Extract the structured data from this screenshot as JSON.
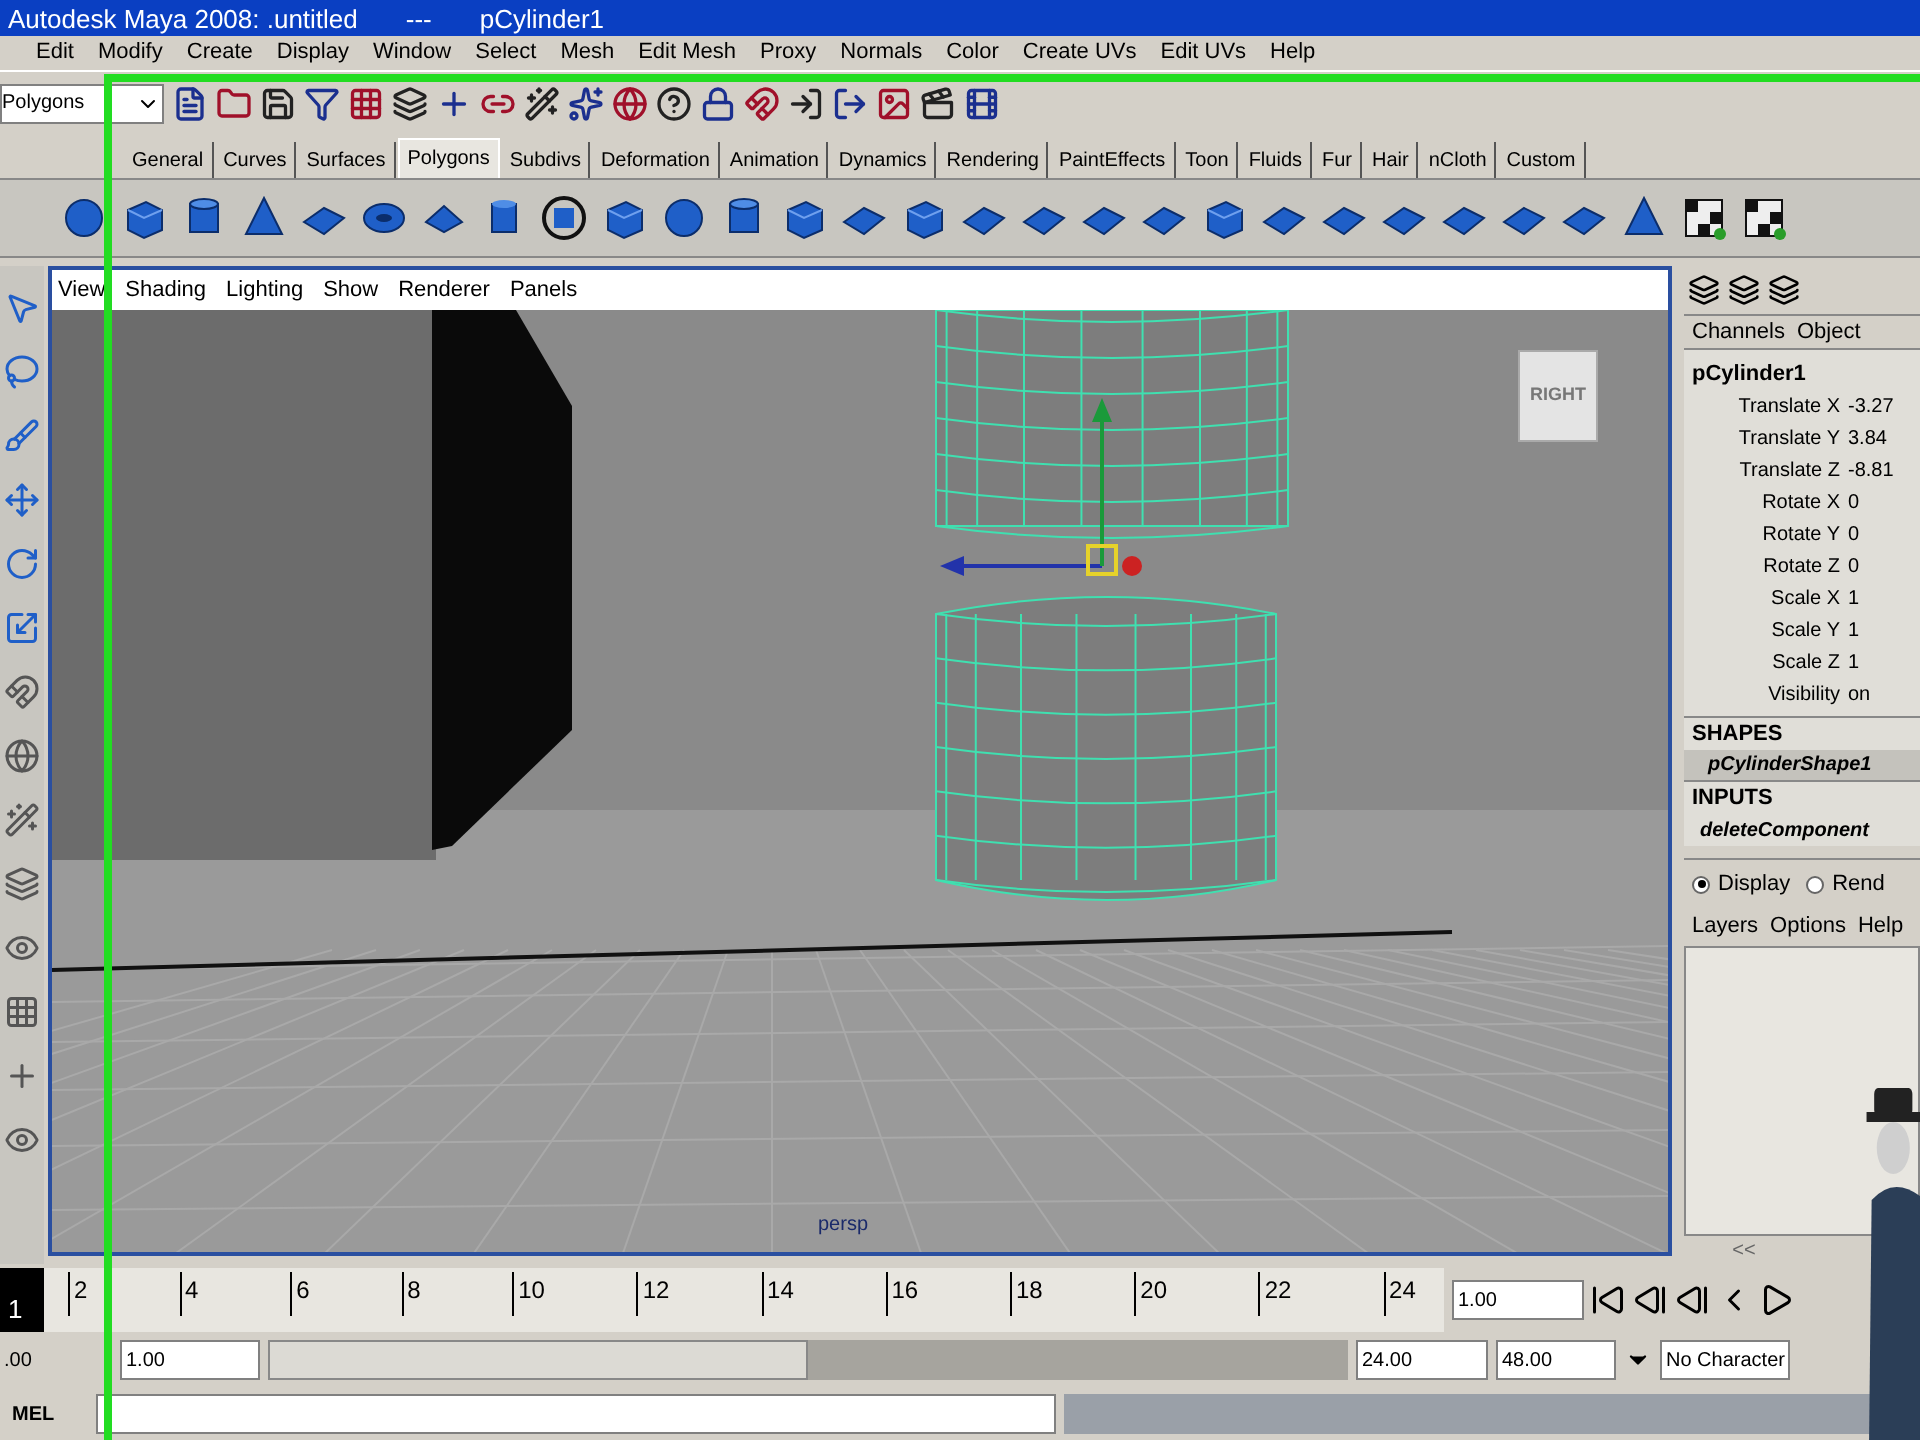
{
  "window": {
    "title": "Autodesk Maya 2008: .untitled",
    "separator": "---",
    "object": "pCylinder1"
  },
  "menu_bar": [
    "Edit",
    "Modify",
    "Create",
    "Display",
    "Window",
    "Select",
    "Mesh",
    "Edit Mesh",
    "Proxy",
    "Normals",
    "Color",
    "Create UVs",
    "Edit UVs",
    "Help"
  ],
  "status_line": {
    "menu_set": "Polygons"
  },
  "shelf_tabs": [
    {
      "label": "General",
      "selected": false
    },
    {
      "label": "Curves",
      "selected": false
    },
    {
      "label": "Surfaces",
      "selected": false
    },
    {
      "label": "Polygons",
      "selected": true
    },
    {
      "label": "Subdivs",
      "selected": false
    },
    {
      "label": "Deformation",
      "selected": false
    },
    {
      "label": "Animation",
      "selected": false
    },
    {
      "label": "Dynamics",
      "selected": false
    },
    {
      "label": "Rendering",
      "selected": false
    },
    {
      "label": "PaintEffects",
      "selected": false
    },
    {
      "label": "Toon",
      "selected": false
    },
    {
      "label": "Fluids",
      "selected": false
    },
    {
      "label": "Fur",
      "selected": false
    },
    {
      "label": "Hair",
      "selected": false
    },
    {
      "label": "nCloth",
      "selected": false
    },
    {
      "label": "Custom",
      "selected": false
    }
  ],
  "viewport": {
    "menu": [
      "View",
      "Shading",
      "Lighting",
      "Show",
      "Renderer",
      "Panels"
    ],
    "view_cube": "RIGHT",
    "camera": "persp"
  },
  "channel_box": {
    "menu": [
      "Channels",
      "Object"
    ],
    "object": "pCylinder1",
    "attributes": [
      {
        "name": "Translate X",
        "value": "-3.27"
      },
      {
        "name": "Translate Y",
        "value": "3.84"
      },
      {
        "name": "Translate Z",
        "value": "-8.81"
      },
      {
        "name": "Rotate X",
        "value": "0"
      },
      {
        "name": "Rotate Y",
        "value": "0"
      },
      {
        "name": "Rotate Z",
        "value": "0"
      },
      {
        "name": "Scale X",
        "value": "1"
      },
      {
        "name": "Scale Y",
        "value": "1"
      },
      {
        "name": "Scale Z",
        "value": "1"
      },
      {
        "name": "Visibility",
        "value": "on"
      }
    ],
    "shapes_heading": "SHAPES",
    "shape": "pCylinderShape1",
    "inputs_heading": "INPUTS",
    "input": "deleteComponent"
  },
  "layer_editor": {
    "modes": [
      {
        "label": "Display",
        "selected": true
      },
      {
        "label": "Rend",
        "selected": false
      }
    ],
    "menu": [
      "Layers",
      "Options",
      "Help"
    ],
    "collapse": "<<"
  },
  "time_slider": {
    "current_frame": "1",
    "ticks": [
      "2",
      "4",
      "6",
      "8",
      "10",
      "12",
      "14",
      "16",
      "18",
      "20",
      "22",
      "24"
    ],
    "current_time": "1.00"
  },
  "range_slider": {
    "start_time": ".00",
    "playback_start": "1.00",
    "level": 0.5,
    "playback_end": "24.00",
    "end_time": "48.00",
    "character_set": "No Character"
  },
  "command_line": {
    "label": "MEL"
  }
}
